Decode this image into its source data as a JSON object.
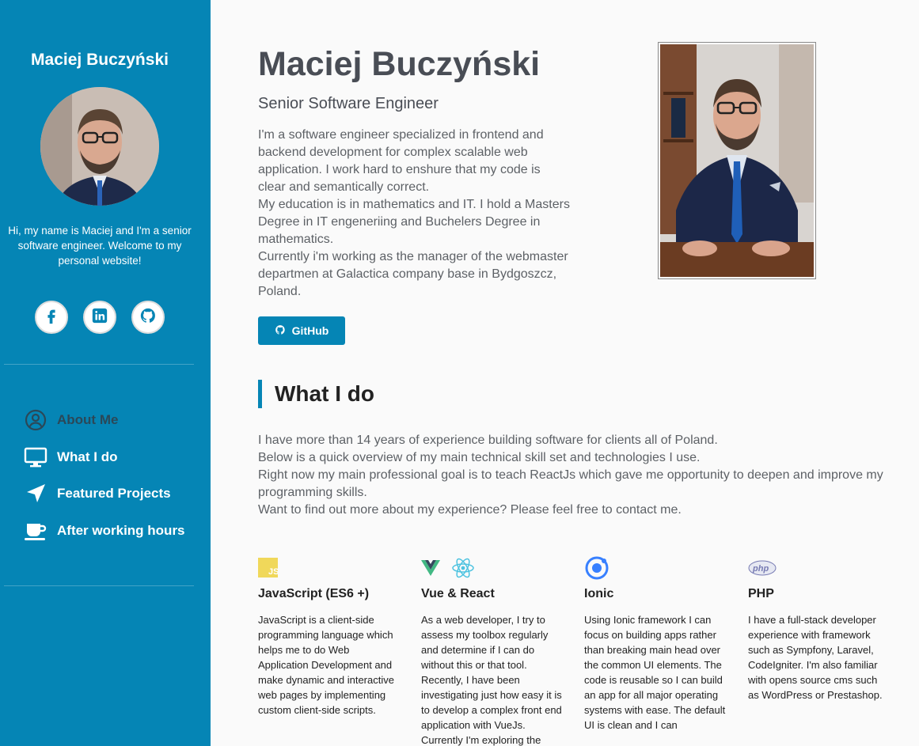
{
  "sidebar": {
    "name": "Maciej Buczyński",
    "intro": "Hi, my name is Maciej and I'm a senior software engineer. Welcome to my personal website!",
    "social": [
      {
        "name": "facebook",
        "icon": "facebook-icon"
      },
      {
        "name": "linkedin",
        "icon": "linkedin-icon"
      },
      {
        "name": "github",
        "icon": "github-icon"
      }
    ],
    "nav": [
      {
        "label": "About Me",
        "icon": "user-circle-icon",
        "active": true
      },
      {
        "label": "What I do",
        "icon": "monitor-icon",
        "active": false
      },
      {
        "label": "Featured Projects",
        "icon": "paper-plane-icon",
        "active": false
      },
      {
        "label": "After working hours",
        "icon": "coffee-cup-icon",
        "active": false
      }
    ]
  },
  "main": {
    "name": "Maciej Buczyński",
    "tagline": "Senior Software Engineer",
    "bio": [
      "I'm a software engineer specialized in frontend and backend development for complex scalable web application. I work hard to enshure that my code is clear and semantically correct.",
      "My education is in mathematics and IT. I hold a Masters Degree in IT engeneriing and Buchelers Degree in mathematics.",
      "Currently i'm working as the manager of the webmaster departmen at Galactica company base in Bydgoszcz, Poland."
    ],
    "github_button": "GitHub",
    "what_i_do": {
      "title": "What I do",
      "paragraphs": [
        "I have more than 14 years of experience building software for clients all of Poland.",
        "Below is a quick overview of my main technical skill set and technologies I use.",
        "Right now my main professional goal is to teach ReactJs which gave me opportunity to deepen and improve my programming skills.",
        "Want to find out more about my experience? Please feel free to contact me."
      ]
    },
    "skills": [
      {
        "title": "JavaScript (ES6 +)",
        "icons": [
          "javascript-icon"
        ],
        "desc": "JavaScript is a client-side programming language which helps me to do Web Application Development and make dynamic and interactive web pages by implementing custom client-side scripts."
      },
      {
        "title": "Vue & React",
        "icons": [
          "vue-icon",
          "react-icon"
        ],
        "desc": "As a web developer, I try to assess my toolbox regularly and determine if I can do without this or that tool. Recently, I have been investigating just how easy it is to develop a complex front end application with VueJs. Currently I'm exploring the"
      },
      {
        "title": "Ionic",
        "icons": [
          "ionic-icon"
        ],
        "desc": "Using Ionic framework I can focus on building apps rather than breaking main head over the common UI elements. The code is reusable so I can build an app for all major operating systems with ease. The default UI is clean and I can"
      },
      {
        "title": "PHP",
        "icons": [
          "php-icon"
        ],
        "desc": "I have a full-stack developer experience with framework such as Sympfony, Laravel, CodeIgniter. I'm also familiar with opens source cms such as WordPress or Prestashop."
      }
    ]
  },
  "colors": {
    "accent": "#0585b5",
    "text": "#494d55",
    "background": "#fafafa"
  }
}
